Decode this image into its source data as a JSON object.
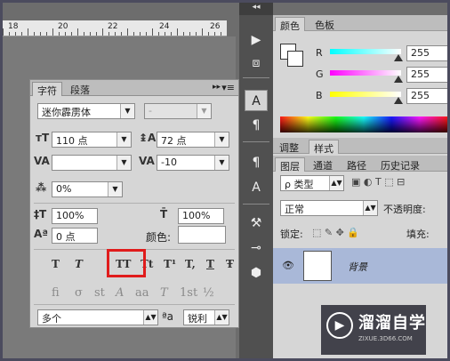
{
  "ruler": {
    "labels": [
      "18",
      "20",
      "22",
      "24",
      "26"
    ]
  },
  "char_panel": {
    "tabs": [
      "字符",
      "段落"
    ],
    "arrows": "▸▸",
    "menu": "▾≡",
    "font_family": "迷你霹雳体",
    "font_style": "-",
    "font_size": "110 点",
    "leading": "72 点",
    "kerning": "",
    "tracking": "-10",
    "scale_pct": "0%",
    "vert_scale": "100%",
    "horiz_scale": "100%",
    "baseline": "0 点",
    "color_label": "颜色:",
    "style_buttons": [
      "T",
      "T",
      "TT",
      "Tt",
      "T¹",
      "T,",
      "T",
      "Ŧ"
    ],
    "ot_buttons": [
      "fi",
      "σ",
      "st",
      "A",
      "aa",
      "T",
      "1st",
      "½"
    ],
    "language": "多个",
    "aa_label": "ªa",
    "aa_value": "锐利"
  },
  "right": {
    "color_tabs": [
      "颜色",
      "色板"
    ],
    "sliders": [
      {
        "label": "R",
        "value": "255",
        "color": "#00ffff"
      },
      {
        "label": "G",
        "value": "255",
        "color": "#ff00ff"
      },
      {
        "label": "B",
        "value": "255",
        "color": "#ffff00"
      }
    ],
    "adjust_tabs": [
      "调整",
      "样式"
    ],
    "layer_tabs": [
      "图层",
      "通道",
      "路径",
      "历史记录"
    ],
    "kind_label": "ρ 类型",
    "blend_mode": "正常",
    "opacity_label": "不透明度:",
    "lock_label": "锁定:",
    "fill_label": "填充:",
    "layer_name": "背景"
  },
  "mid_col": {
    "collapse": "◂◂"
  },
  "watermark": {
    "title": "溜溜自学",
    "sub": "ZIXUE.3D66.COM"
  }
}
